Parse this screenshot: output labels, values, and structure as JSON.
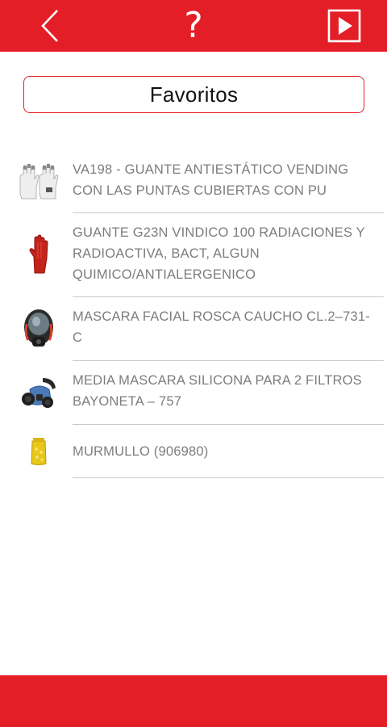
{
  "header": {
    "back_icon": "chevron-left-icon",
    "help_label": "?",
    "play_icon": "play-icon",
    "color": "#e41e26"
  },
  "favorites": {
    "title": "Favoritos",
    "items": [
      {
        "text": "VA198 - GUANTE ANTIESTÁTICO VENDING CON LAS PUNTAS CUBIERTAS CON PU",
        "icon": "white-glove-thumbnail"
      },
      {
        "text": "GUANTE G23N VINDICO 100 RADIACIONES Y RADIOACTIVA, BACT, ALGUN QUIMICO/ANTIALERGENICO",
        "icon": "red-glove-thumbnail"
      },
      {
        "text": "MASCARA FACIAL ROSCA CAUCHO CL.2–731-C",
        "icon": "full-face-mask-thumbnail"
      },
      {
        "text": "MEDIA MASCARA SILICONA PARA 2 FILTROS BAYONETA – 757",
        "icon": "half-mask-thumbnail"
      },
      {
        "text": "MURMULLO (906980)",
        "icon": "earplugs-thumbnail"
      }
    ]
  }
}
